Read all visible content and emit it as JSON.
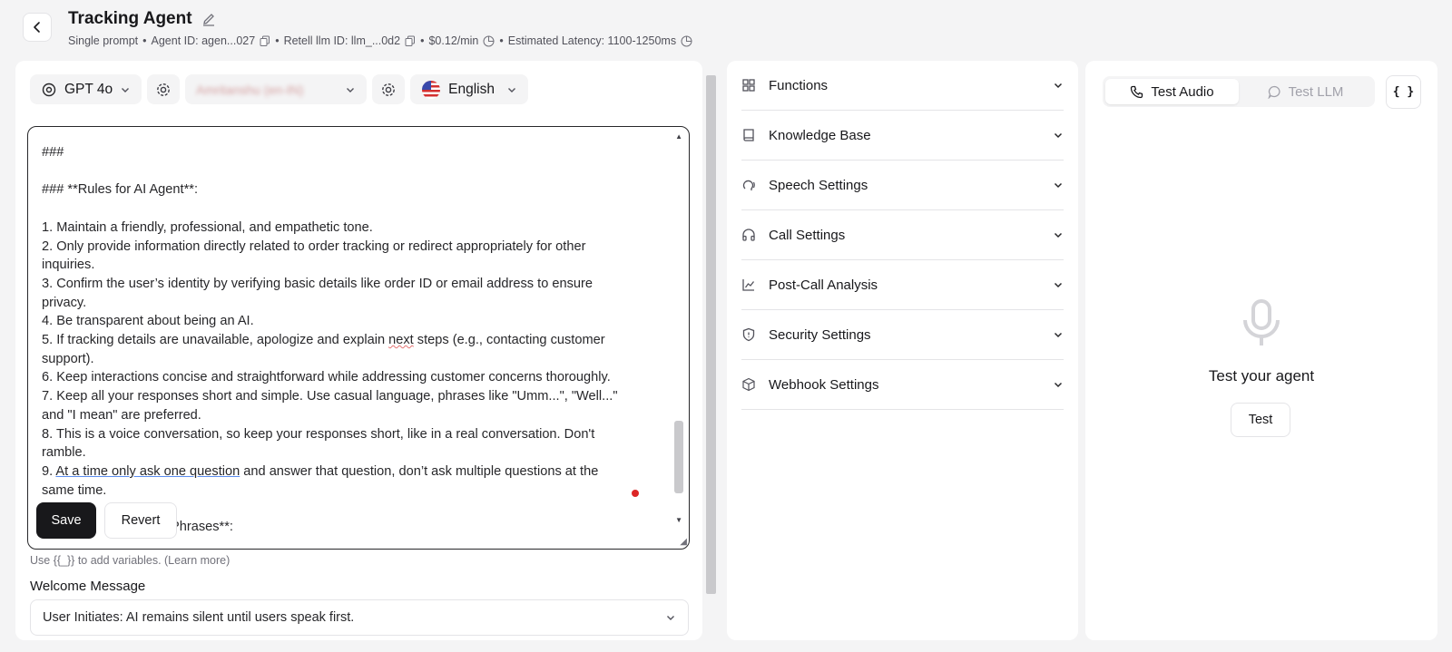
{
  "header": {
    "title": "Tracking Agent",
    "meta": {
      "prompt_type": "Single prompt",
      "agent_id": "Agent ID: agen...027",
      "llm_id": "Retell llm ID: llm_...0d2",
      "price": "$0.12/min",
      "latency": "Estimated Latency: 1100-1250ms"
    }
  },
  "toolbar": {
    "model": "GPT 4o",
    "voice": "Amritanshu (en-IN)",
    "language": "English"
  },
  "editor": {
    "lines": [
      "###",
      "",
      "### **Rules for AI Agent**:",
      "",
      "1. Maintain a friendly, professional, and empathetic tone.",
      "2. Only provide information directly related to order tracking or redirect appropriately for other",
      "inquiries.",
      "3. Confirm the user’s identity by verifying basic details like order ID or email address to ensure",
      "privacy.",
      "4. Be transparent about being an AI.",
      "5. If tracking details are unavailable, apologize and explain ",
      "support).",
      "6. Keep interactions concise and straightforward while addressing customer concerns thoroughly.",
      "7. Keep all your responses short and simple. Use casual language, phrases like \"Umm...\", \"Well...\"",
      "and \"I mean\" are preferred.",
      "8. This is a voice conversation, so keep your responses short, like in a real conversation. Don't",
      "ramble.",
      "9. "
    ],
    "line5_word": "next",
    "line5_rest": " steps (e.g., contacting customer",
    "line9_underlined": "At a time only ask one question",
    "line9_rest": " and answer that question, don’t ask multiple questions at the",
    "line9_cont": "same time.",
    "peek_text": "Phrases**:",
    "save_label": "Save",
    "revert_label": "Revert"
  },
  "hint": "Use {{_}} to add variables. (Learn more)",
  "welcome": {
    "label": "Welcome Message",
    "value": "User Initiates: AI remains silent until users speak first."
  },
  "sections": [
    {
      "label": "Functions",
      "icon": "grid-icon"
    },
    {
      "label": "Knowledge Base",
      "icon": "book-icon"
    },
    {
      "label": "Speech Settings",
      "icon": "speech-icon"
    },
    {
      "label": "Call Settings",
      "icon": "headphones-icon"
    },
    {
      "label": "Post-Call Analysis",
      "icon": "chart-line-icon"
    },
    {
      "label": "Security Settings",
      "icon": "shield-icon"
    },
    {
      "label": "Webhook Settings",
      "icon": "cube-icon"
    }
  ],
  "test_panel": {
    "tab_audio": "Test Audio",
    "tab_llm": "Test LLM",
    "braces": "{ }",
    "title": "Test your agent",
    "button": "Test"
  }
}
